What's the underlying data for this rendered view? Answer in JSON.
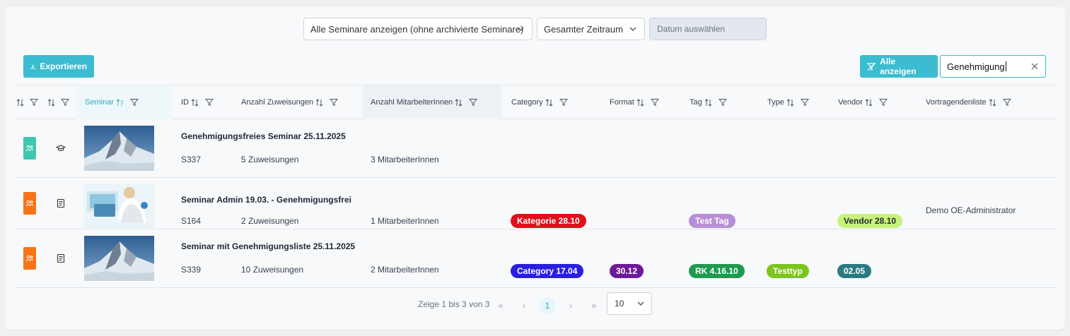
{
  "filters": {
    "seminar_select": "Alle Seminare anzeigen (ohne archivierte Seminare)",
    "period_select": "Gesamter Zeitraum",
    "date_placeholder": "Datum auswählen"
  },
  "toolbar": {
    "export_label": "Exportieren",
    "show_all_label": "Alle anzeigen",
    "search_value": "Genehmigung"
  },
  "columns": {
    "seminar": "Seminar",
    "id": "ID",
    "assignments": "Anzahl Zuweisungen",
    "employees": "Anzahl MitarbeiterInnen",
    "category": "Category",
    "format": "Format",
    "tag": "Tag",
    "type": "Type",
    "vendor": "Vendor",
    "speakers": "Vortragendenliste"
  },
  "colors": {
    "accent": "#3cbcd0",
    "status_green": "#3ec8b0",
    "status_orange": "#f97316"
  },
  "rows": [
    {
      "status_color": "#3ec8b0",
      "type_icon": "graduation-cap-icon",
      "image": "mountain",
      "title": "Genehmigungsfreies Seminar 25.11.2025",
      "id": "S337",
      "assignments": "5 Zuweisungen",
      "employees": "3 MitarbeiterInnen"
    },
    {
      "status_color": "#f97316",
      "type_icon": "document-icon",
      "image": "person-laptop",
      "title": "Seminar Admin 19.03. - Genehmigungsfrei",
      "id": "S164",
      "assignments": "2 Zuweisungen",
      "employees": "1 MitarbeiterInnen",
      "category": {
        "label": "Kategorie 28.10",
        "color": "#e0101a"
      },
      "tag": {
        "label": "Test Tag",
        "color": "#b88fd6"
      },
      "vendor": {
        "label": "Vendor 28.10",
        "color": "#c8f27a",
        "text_color": "#1f2937"
      },
      "speakers": "Demo OE-Administrator"
    },
    {
      "status_color": "#f97316",
      "type_icon": "document-icon",
      "image": "mountain",
      "title": "Seminar mit Genehmigungsliste 25.11.2025",
      "id": "S339",
      "assignments": "10 Zuweisungen",
      "employees": "2 MitarbeiterInnen",
      "category": {
        "label": "Category 17.04",
        "color": "#2a1fe0"
      },
      "format": {
        "label": "30.12",
        "color": "#6d1a99"
      },
      "tag": {
        "label": "RK 4.16.10",
        "color": "#1f9a4e"
      },
      "type": {
        "label": "Testtyp",
        "color": "#7cc41f"
      },
      "vendor": {
        "label": "02.05",
        "color": "#2b7a82"
      }
    }
  ],
  "pagination": {
    "summary": "Zeige 1 bis 3 von 3",
    "first": "«",
    "prev": "‹",
    "current_page": "1",
    "next": "›",
    "last": "»",
    "page_size": "10"
  }
}
